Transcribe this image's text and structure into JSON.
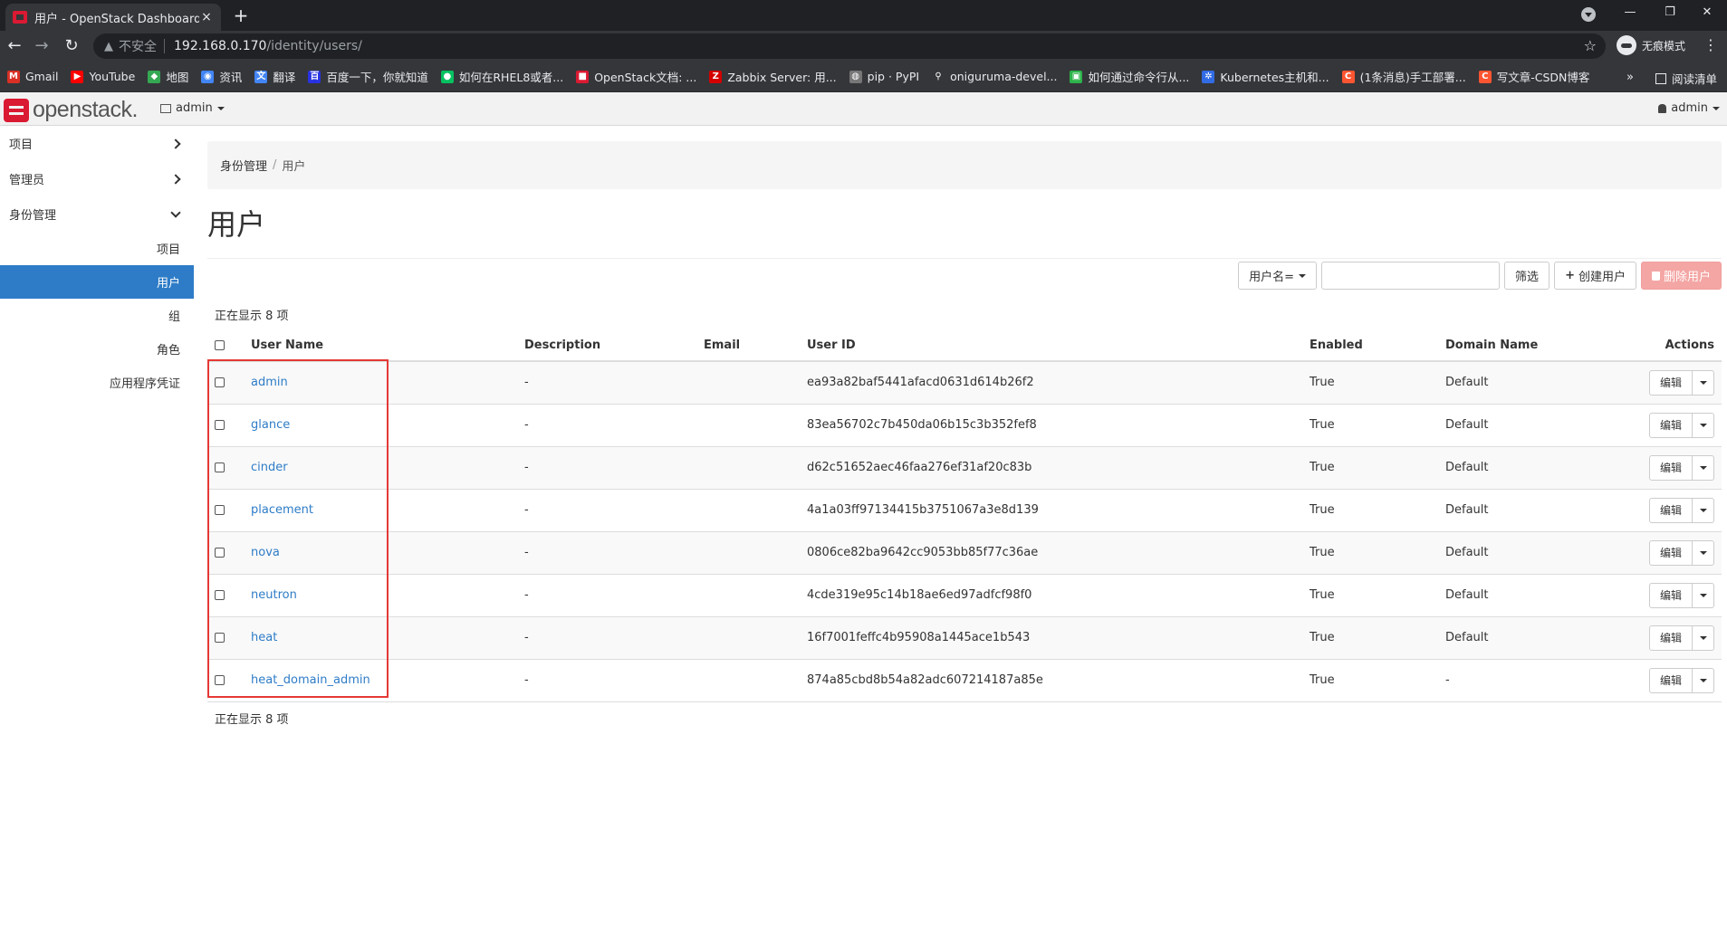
{
  "browser": {
    "tab_title": "用户 - OpenStack Dashboard",
    "tab_close": "×",
    "new_tab": "+",
    "security_label": "不安全",
    "url_host": "192.168.0.170",
    "url_path": "/identity/users/",
    "incognito_label": "无痕模式",
    "bookmarks": [
      {
        "label": "Gmail",
        "icon": "gmail-icon",
        "color": "#d93025",
        "glyph": "M"
      },
      {
        "label": "YouTube",
        "icon": "youtube-icon",
        "color": "#ff0000",
        "glyph": "▶"
      },
      {
        "label": "地图",
        "icon": "maps-icon",
        "color": "#34a853",
        "glyph": "◆"
      },
      {
        "label": "资讯",
        "icon": "news-icon",
        "color": "#4285f4",
        "glyph": "◉"
      },
      {
        "label": "翻译",
        "icon": "translate-icon",
        "color": "#4285f4",
        "glyph": "文"
      },
      {
        "label": "百度一下，你就知道",
        "icon": "baidu-icon",
        "color": "#2932e1",
        "glyph": "百"
      },
      {
        "label": "如何在RHEL8或者...",
        "icon": "wechat-icon",
        "color": "#07c160",
        "glyph": "●"
      },
      {
        "label": "OpenStack文档: ...",
        "icon": "openstack-icon",
        "color": "#da1a32",
        "glyph": "■"
      },
      {
        "label": "Zabbix Server: 用...",
        "icon": "zabbix-icon",
        "color": "#d40000",
        "glyph": "Z"
      },
      {
        "label": "pip · PyPI",
        "icon": "pypi-icon",
        "color": "#777777",
        "glyph": "◍"
      },
      {
        "label": "oniguruma-devel...",
        "icon": "search-icon",
        "color": "#35363a",
        "glyph": "⚲"
      },
      {
        "label": "如何通过命令行从...",
        "icon": "blog-icon",
        "color": "#2db34a",
        "glyph": "▣"
      },
      {
        "label": "Kubernetes主机和...",
        "icon": "kubernetes-icon",
        "color": "#326ce5",
        "glyph": "✲"
      },
      {
        "label": "(1条消息)手工部署...",
        "icon": "csdn-icon",
        "color": "#fc5531",
        "glyph": "C"
      },
      {
        "label": "写文章-CSDN博客",
        "icon": "csdn-icon",
        "color": "#fc5531",
        "glyph": "C"
      }
    ],
    "more_bookmarks": "»",
    "reading_list": "阅读清单"
  },
  "header": {
    "logo_text": "openstack.",
    "project": "admin",
    "user": "admin"
  },
  "sidebar": {
    "top": [
      {
        "label": "项目",
        "name": "project"
      },
      {
        "label": "管理员",
        "name": "admin"
      },
      {
        "label": "身份管理",
        "name": "identity"
      }
    ],
    "sub": [
      {
        "label": "项目",
        "name": "projects"
      },
      {
        "label": "用户",
        "name": "users"
      },
      {
        "label": "组",
        "name": "groups"
      },
      {
        "label": "角色",
        "name": "roles"
      },
      {
        "label": "应用程序凭证",
        "name": "app-credentials"
      }
    ]
  },
  "breadcrumb": {
    "parent": "身份管理",
    "divider": "/",
    "current": "用户"
  },
  "page_title": "用户",
  "filter": {
    "select_label": "用户名=",
    "value": "",
    "filter_button": "筛选",
    "create_button": "创建用户",
    "delete_button": "删除用户"
  },
  "count_text": "正在显示 8 项",
  "table": {
    "headers": {
      "name": "User Name",
      "description": "Description",
      "email": "Email",
      "id": "User ID",
      "enabled": "Enabled",
      "domain": "Domain Name",
      "actions": "Actions"
    },
    "edit_label": "编辑",
    "rows": [
      {
        "name": "admin",
        "description": "-",
        "email": "",
        "id": "ea93a82baf5441afacd0631d614b26f2",
        "enabled": "True",
        "domain": "Default"
      },
      {
        "name": "glance",
        "description": "-",
        "email": "",
        "id": "83ea56702c7b450da06b15c3b352fef8",
        "enabled": "True",
        "domain": "Default"
      },
      {
        "name": "cinder",
        "description": "-",
        "email": "",
        "id": "d62c51652aec46faa276ef31af20c83b",
        "enabled": "True",
        "domain": "Default"
      },
      {
        "name": "placement",
        "description": "-",
        "email": "",
        "id": "4a1a03ff97134415b3751067a3e8d139",
        "enabled": "True",
        "domain": "Default"
      },
      {
        "name": "nova",
        "description": "-",
        "email": "",
        "id": "0806ce82ba9642cc9053bb85f77c36ae",
        "enabled": "True",
        "domain": "Default"
      },
      {
        "name": "neutron",
        "description": "-",
        "email": "",
        "id": "4cde319e95c14b18ae6ed97adfcf98f0",
        "enabled": "True",
        "domain": "Default"
      },
      {
        "name": "heat",
        "description": "-",
        "email": "",
        "id": "16f7001feffc4b95908a1445ace1b543",
        "enabled": "True",
        "domain": "Default"
      },
      {
        "name": "heat_domain_admin",
        "description": "-",
        "email": "",
        "id": "874a85cbd8b54a82adc607214187a85e",
        "enabled": "True",
        "domain": "-"
      }
    ]
  },
  "colors": {
    "primary": "#2e7cc7",
    "danger": "#f4a6a4",
    "highlight": "#e53935",
    "openstack_red": "#da1a32"
  }
}
